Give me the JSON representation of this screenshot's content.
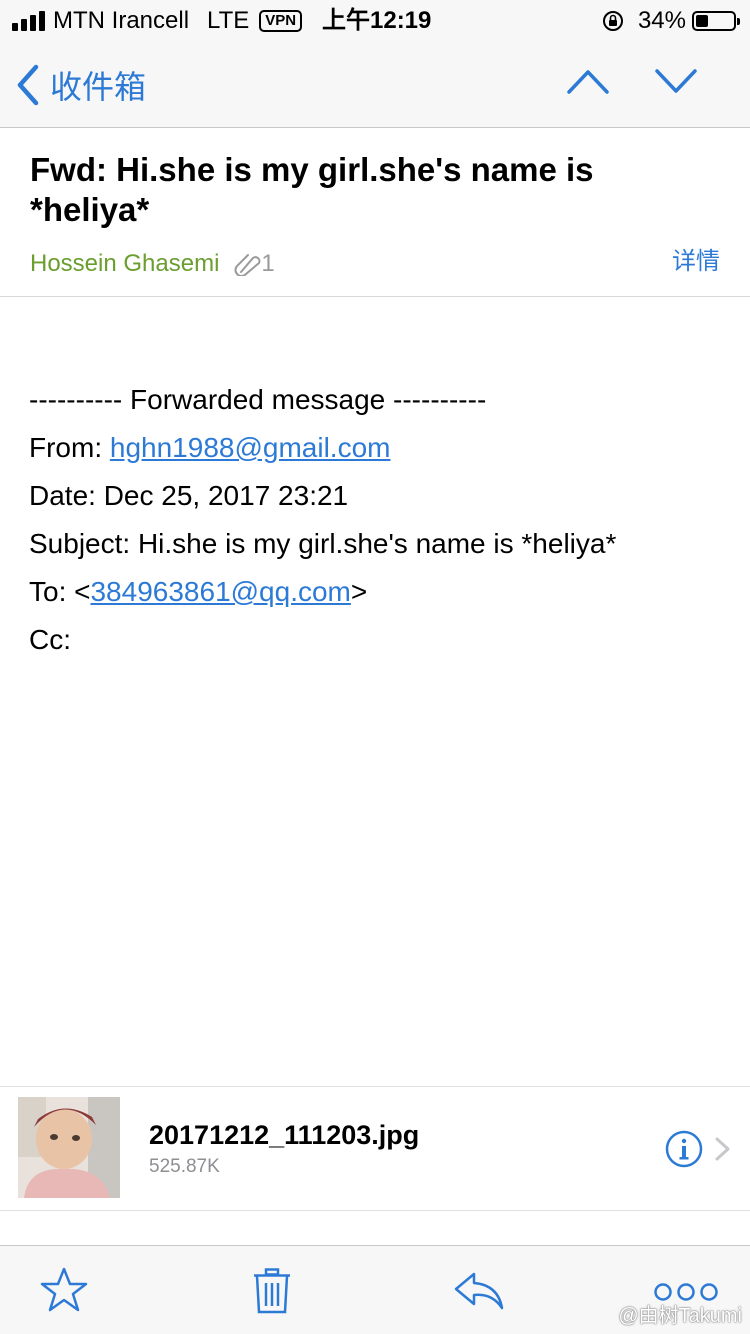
{
  "status_bar": {
    "carrier": "MTN Irancell",
    "network": "LTE",
    "vpn": "VPN",
    "time": "上午12:19",
    "battery_percent": "34%",
    "battery_level": 0.34
  },
  "nav": {
    "back_label": "收件箱",
    "icons": [
      "back-chevron-icon",
      "up-arrow-icon",
      "down-arrow-icon"
    ],
    "accent_color": "#2d7ad6"
  },
  "message": {
    "subject": "Fwd: Hi.she is my girl.she's name is *heliya*",
    "sender": "Hossein Ghasemi",
    "sender_color": "#6a9e2f",
    "attachment_count": "1",
    "details_label": "详情"
  },
  "body": {
    "forwarded_line": "---------- Forwarded message ----------",
    "from_label": "From: ",
    "from_email": "hghn1988@gmail.com",
    "date_line": "Date: Dec 25, 2017 23:21",
    "subject_line": "Subject: Hi.she is my girl.she's name is *heliya*",
    "to_label": "To: <",
    "to_email": "384963861@qq.com",
    "to_close": ">",
    "cc_line": "Cc:"
  },
  "attachment": {
    "filename": "20171212_111203.jpg",
    "size": "525.87K"
  },
  "toolbar": {
    "icons": [
      "star-icon",
      "trash-icon",
      "reply-icon",
      "more-icon"
    ]
  },
  "watermark": "@由树Takumi"
}
